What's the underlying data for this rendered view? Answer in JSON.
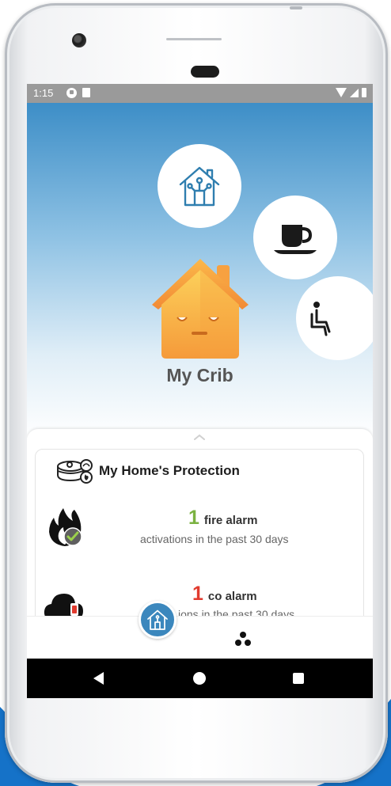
{
  "status": {
    "time": "1:15"
  },
  "hero": {
    "title": "My Crib",
    "bubbles": [
      "house-network-icon",
      "coffee-cup-icon",
      "seated-person-icon"
    ]
  },
  "protection": {
    "title": "My Home's Protection",
    "rows": [
      {
        "count": "1",
        "label": "fire alarm",
        "description": "activations in the past 30 days",
        "icon": "fire-check-icon",
        "color": "#7bb241"
      },
      {
        "count": "1",
        "label": "co alarm",
        "description": "ions in the past 30 days",
        "icon": "co-cloud-alert-icon",
        "color": "#e13b2f"
      }
    ]
  },
  "nav": {
    "items": [
      "home-tab",
      "more-tab"
    ]
  },
  "colors": {
    "brand_blue": "#3b87bd",
    "house_orange": "#f9a83a"
  }
}
